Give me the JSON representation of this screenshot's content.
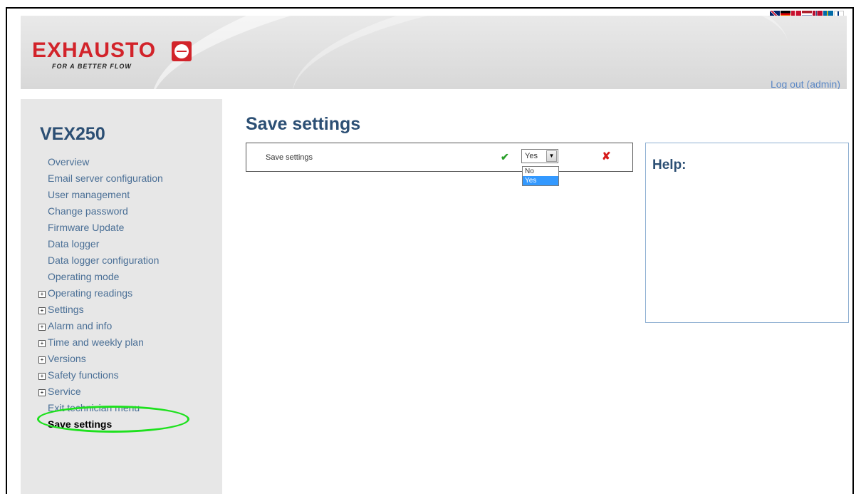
{
  "brand": {
    "name": "EXHAUSTO",
    "tagline": "FOR A BETTER FLOW",
    "color": "#d2232a"
  },
  "header": {
    "logout_label": "Log out (admin)"
  },
  "languages": [
    "uk-flag-icon",
    "de-flag-icon",
    "dk-flag-icon",
    "nl-flag-icon",
    "no-flag-icon",
    "se-flag-icon",
    "fi-flag-icon"
  ],
  "sidebar": {
    "device": "VEX250",
    "items": [
      {
        "label": "Overview",
        "expandable": false
      },
      {
        "label": "Email server configuration",
        "expandable": false
      },
      {
        "label": "User management",
        "expandable": false
      },
      {
        "label": "Change password",
        "expandable": false
      },
      {
        "label": "Firmware Update",
        "expandable": false
      },
      {
        "label": "Data logger",
        "expandable": false
      },
      {
        "label": "Data logger configuration",
        "expandable": false
      },
      {
        "label": "Operating mode",
        "expandable": false
      },
      {
        "label": "Operating readings",
        "expandable": true
      },
      {
        "label": "Settings",
        "expandable": true
      },
      {
        "label": "Alarm and info",
        "expandable": true
      },
      {
        "label": "Time and weekly plan",
        "expandable": true
      },
      {
        "label": "Versions",
        "expandable": true
      },
      {
        "label": "Safety functions",
        "expandable": true
      },
      {
        "label": "Service",
        "expandable": true
      },
      {
        "label": "Exit technician menu",
        "expandable": false
      },
      {
        "label": "Save settings",
        "expandable": false,
        "active": true
      }
    ]
  },
  "main": {
    "title": "Save settings",
    "setting": {
      "label": "Save settings",
      "value": "Yes",
      "options": [
        "No",
        "Yes"
      ],
      "highlighted_option": "Yes"
    }
  },
  "help": {
    "title": "Help:"
  }
}
